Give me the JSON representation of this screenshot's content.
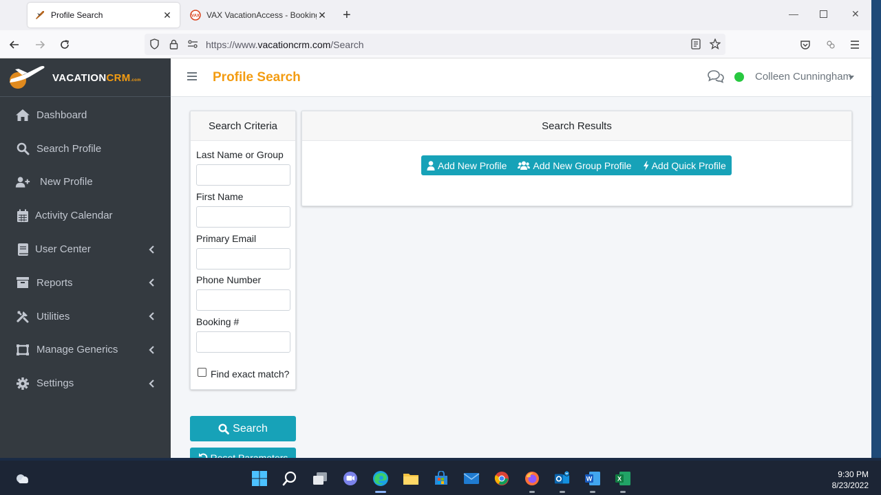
{
  "browser": {
    "tabs": [
      {
        "title": "Profile Search",
        "active": true
      },
      {
        "title": "VAX VacationAccess - Booking Engine",
        "active": false
      }
    ],
    "url_prefix": "https://www.",
    "url_domain": "vacationcrm.com",
    "url_path": "/Search"
  },
  "brand": {
    "name_white": "VACATION",
    "name_orange": "CRM",
    "suffix": ".com"
  },
  "sidebar": {
    "items": [
      {
        "label": "Dashboard",
        "icon": "home-icon",
        "has_submenu": false
      },
      {
        "label": "Search Profile",
        "icon": "search-icon",
        "has_submenu": false
      },
      {
        "label": "New Profile",
        "icon": "user-plus-icon",
        "has_submenu": false
      },
      {
        "label": "Activity Calendar",
        "icon": "calendar-icon",
        "has_submenu": false
      },
      {
        "label": "User Center",
        "icon": "book-icon",
        "has_submenu": true
      },
      {
        "label": "Reports",
        "icon": "archive-icon",
        "has_submenu": true
      },
      {
        "label": "Utilities",
        "icon": "tools-icon",
        "has_submenu": true
      },
      {
        "label": "Manage Generics",
        "icon": "generic-icon",
        "has_submenu": true
      },
      {
        "label": "Settings",
        "icon": "gear-icon",
        "has_submenu": true
      }
    ]
  },
  "header": {
    "title": "Profile Search",
    "user_name": "Colleen Cunningham",
    "status_color": "#28c840"
  },
  "criteria": {
    "title": "Search Criteria",
    "fields": [
      {
        "label": "Last Name or Group",
        "value": ""
      },
      {
        "label": "First Name",
        "value": ""
      },
      {
        "label": "Primary Email",
        "value": ""
      },
      {
        "label": "Phone Number",
        "value": ""
      },
      {
        "label": "Booking #",
        "value": ""
      }
    ],
    "exact_match_label": "Find exact match?",
    "exact_match_checked": false
  },
  "results": {
    "title": "Search Results",
    "add_profile_label": "Add New Profile",
    "add_group_label": "Add New Group Profile",
    "add_quick_label": "Add Quick Profile"
  },
  "actions": {
    "search_label": "Search",
    "reset_label": "Reset Parameters"
  },
  "taskbar": {
    "time": "9:30 PM",
    "date": "8/23/2022"
  },
  "colors": {
    "accent": "#f39c12",
    "button": "#17a2b8",
    "sidebar_bg": "#343a40"
  }
}
